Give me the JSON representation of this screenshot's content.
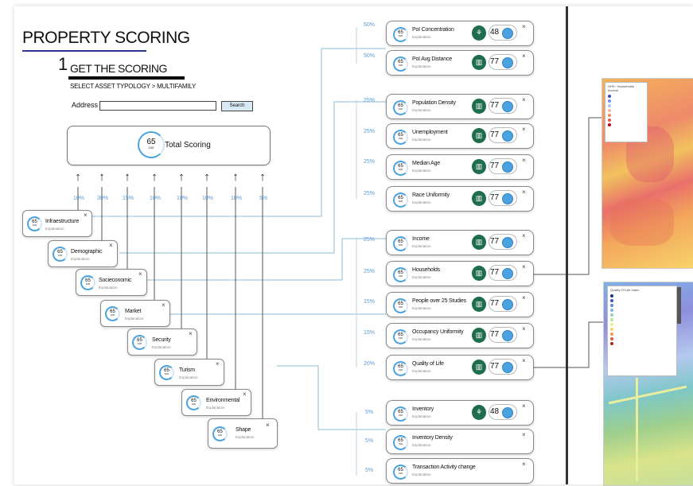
{
  "page": {
    "title": "PROPERTY SCORING",
    "step_number": "1",
    "step_title": "GET THE SCORING",
    "typology": "SELECT ASSET TYPOLOGY > MULTIFAMILY"
  },
  "address": {
    "label": "Address",
    "value": "",
    "search_label": "Search"
  },
  "total": {
    "score": "65",
    "sub": "100",
    "label": "Total Scoring"
  },
  "weights": [
    "10%",
    "30%",
    "15%",
    "10%",
    "10%",
    "10%",
    "10%",
    "5%"
  ],
  "categories": [
    {
      "name": "Infraestructure",
      "score": "65",
      "sub": "100",
      "explanation": "Explanation"
    },
    {
      "name": "Demographic",
      "score": "65",
      "sub": "100",
      "explanation": "Explanation"
    },
    {
      "name": "Socieconomic",
      "score": "65",
      "sub": "100",
      "explanation": "Explanation"
    },
    {
      "name": "Market",
      "score": "65",
      "sub": "100",
      "explanation": "Explanation"
    },
    {
      "name": "Security",
      "score": "65",
      "sub": "100",
      "explanation": "Explanation"
    },
    {
      "name": "Turism",
      "score": "65",
      "sub": "100",
      "explanation": "Explanation"
    },
    {
      "name": "Environmental",
      "score": "65",
      "sub": "100",
      "explanation": "Explanation"
    },
    {
      "name": "Shape",
      "score": "65",
      "sub": "100",
      "explanation": "Explanation"
    }
  ],
  "close_symbol": "×",
  "subfactors": [
    {
      "pct": "50%",
      "name": "PoI Concentration",
      "explanation": "Explanation",
      "score": "65",
      "sub": "100",
      "badge": "⚘",
      "value": "48"
    },
    {
      "pct": "50%",
      "name": "PoI Avg Distance",
      "explanation": "Explanation",
      "score": "65",
      "sub": "100",
      "badge": "▥",
      "value": "77"
    },
    {
      "pct": "25%",
      "name": "Population Density",
      "explanation": "Explanation",
      "score": "65",
      "sub": "100",
      "badge": "▥",
      "value": "77"
    },
    {
      "pct": "25%",
      "name": "Unemployment",
      "explanation": "Explanation",
      "score": "65",
      "sub": "100",
      "badge": "▥",
      "value": "77"
    },
    {
      "pct": "25%",
      "name": "Median Age",
      "explanation": "Explanation",
      "score": "65",
      "sub": "100",
      "badge": "▥",
      "value": "77"
    },
    {
      "pct": "25%",
      "name": "Race Uniformity",
      "explanation": "Explanation",
      "score": "65",
      "sub": "100",
      "badge": "▥",
      "value": "77"
    },
    {
      "pct": "25%",
      "name": "Income",
      "explanation": "Explanation",
      "score": "65",
      "sub": "100",
      "badge": "▥",
      "value": "77"
    },
    {
      "pct": "25%",
      "name": "Households",
      "explanation": "Explanation",
      "score": "65",
      "sub": "100",
      "badge": "▥",
      "value": "77"
    },
    {
      "pct": "15%",
      "name": "People over 25 Studies",
      "explanation": "Explanation",
      "score": "65",
      "sub": "100",
      "badge": "▥",
      "value": "77"
    },
    {
      "pct": "15%",
      "name": "Occupancy Uniformity",
      "explanation": "Explanation",
      "score": "65",
      "sub": "100",
      "badge": "▥",
      "value": "77"
    },
    {
      "pct": "20%",
      "name": "Quality of Life",
      "explanation": "Explanation",
      "score": "65",
      "sub": "100",
      "badge": "▥",
      "value": "77"
    },
    {
      "pct": "5%",
      "name": "Inventory",
      "explanation": "Explanation",
      "score": "65",
      "sub": "100",
      "badge": "⚘",
      "value": "48"
    },
    {
      "pct": "5%",
      "name": "Inventory Density",
      "explanation": "Explanation",
      "score": "65",
      "sub": "100",
      "badge": "",
      "value": ""
    },
    {
      "pct": "5%",
      "name": "Transaction Activity change",
      "explanation": "Explanation",
      "score": "65",
      "sub": "100",
      "badge": "",
      "value": ""
    }
  ],
  "maps": [
    {
      "legend_title": "HHS / Households Income"
    },
    {
      "legend_title": "Quality Of Life Index"
    }
  ],
  "colors": {
    "accent": "#4aa3df",
    "badge": "#1e6e4e",
    "percent": "#5b9bd5"
  }
}
